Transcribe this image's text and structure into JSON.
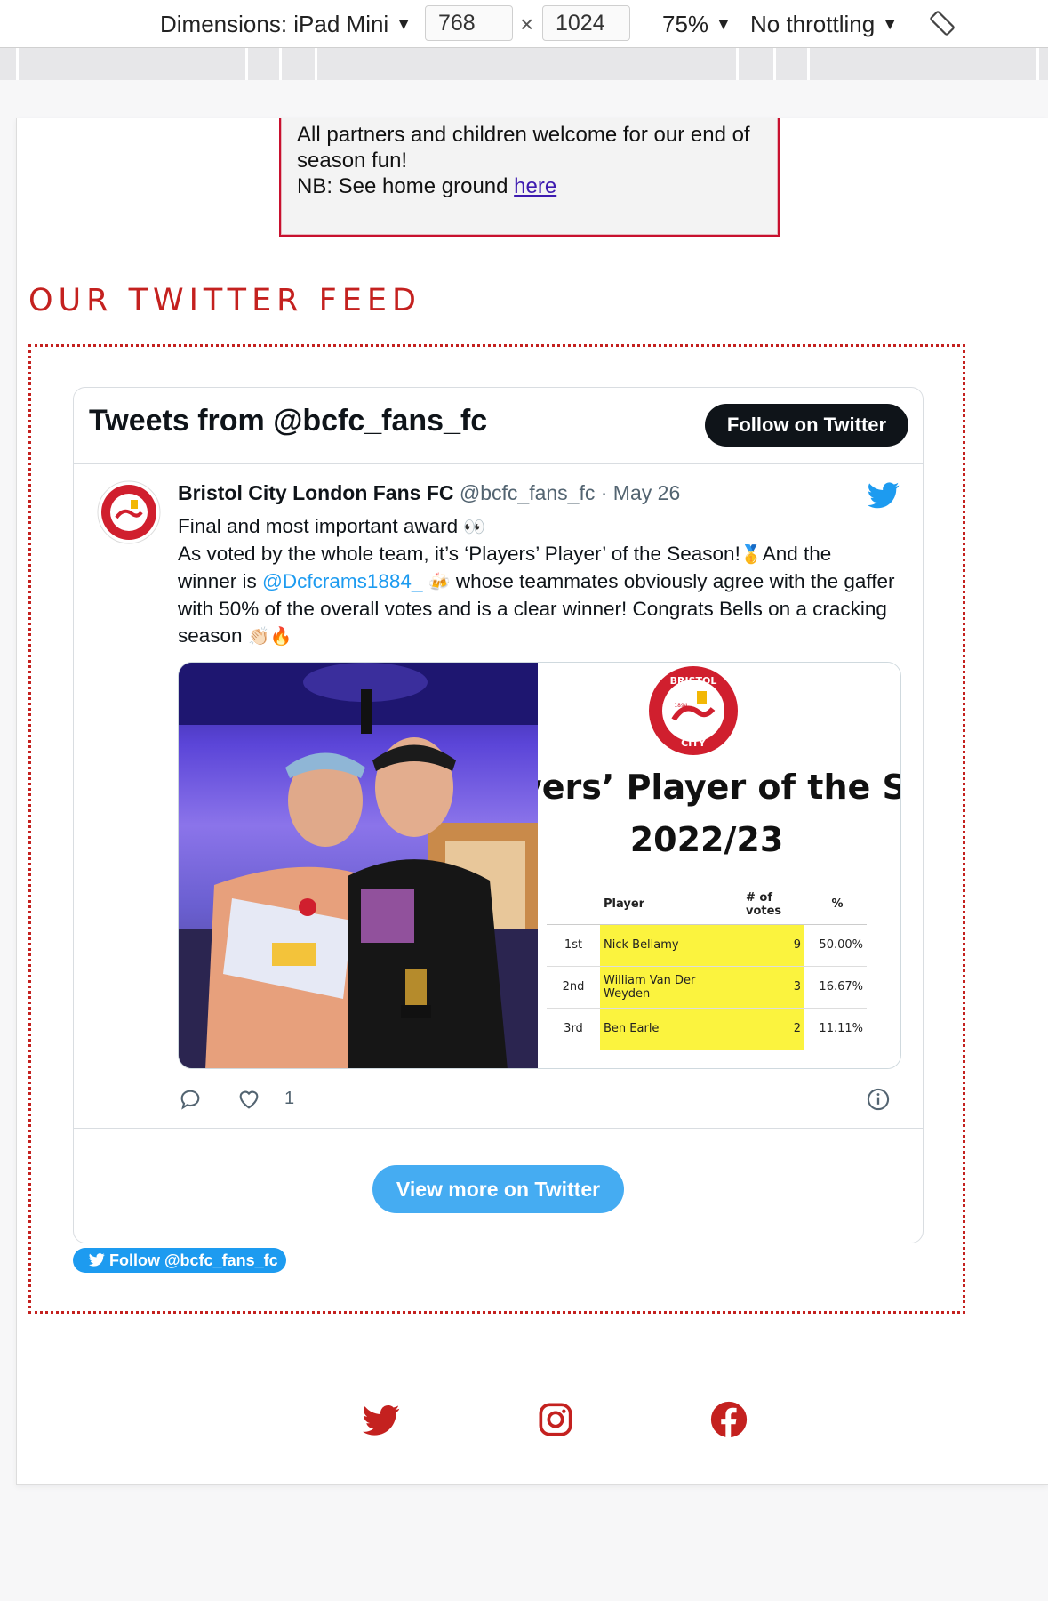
{
  "devtools": {
    "dimensions_label": "Dimensions: iPad Mini",
    "width_value": "768",
    "times_sign": "×",
    "height_value": "1024",
    "zoom": "75%",
    "throttling": "No throttling"
  },
  "event": {
    "line1": "All partners and children welcome for our end of season fun!",
    "line2_prefix": "NB: See home ground ",
    "line2_link": "here"
  },
  "section": {
    "title": "OUR TWITTER FEED"
  },
  "timeline": {
    "title": "Tweets from @bcfc_fans_fc",
    "follow_button": "Follow on Twitter",
    "view_more": "View more on Twitter",
    "follow_pill": "Follow @bcfc_fans_fc"
  },
  "tweet": {
    "author": "Bristol City London Fans FC",
    "handle_date": "@bcfc_fans_fc · May 26",
    "line1": "Final and most important award",
    "line2": "As voted by the whole team, it’s ‘Players’ Player’ of the Season!",
    "line2_end": "And the",
    "line3_prefix": "winner is ",
    "mention": "@Dcfcrams1884_",
    "line3_rest": " whose teammates obviously agree with the gaffer with 50% of the overall votes and is a clear winner! Congrats Bells on a cracking season",
    "like_count": "1"
  },
  "graphic": {
    "title_line1": "yers’ Player of the Seasc",
    "title_line2": "2022/23",
    "badge_top": "BRISTOL",
    "badge_bottom": "CITY",
    "badge_year": "1894",
    "headers": [
      "",
      "Player",
      "# of votes",
      "%"
    ],
    "rows": [
      {
        "rank": "1st",
        "player": "Nick Bellamy",
        "votes": "9",
        "pct": "50.00%"
      },
      {
        "rank": "2nd",
        "player": "William Van Der Weyden",
        "votes": "3",
        "pct": "16.67%"
      },
      {
        "rank": "3rd",
        "player": "Ben Earle",
        "votes": "2",
        "pct": "11.11%"
      }
    ]
  },
  "colors": {
    "accent_red": "#c4211f",
    "twitter_blue": "#1d9bf0",
    "highlight_yellow": "#fbf33e"
  },
  "icons": [
    "twitter-icon",
    "instagram-icon",
    "facebook-icon",
    "reply-icon",
    "heart-icon",
    "info-icon",
    "rotate-icon"
  ]
}
